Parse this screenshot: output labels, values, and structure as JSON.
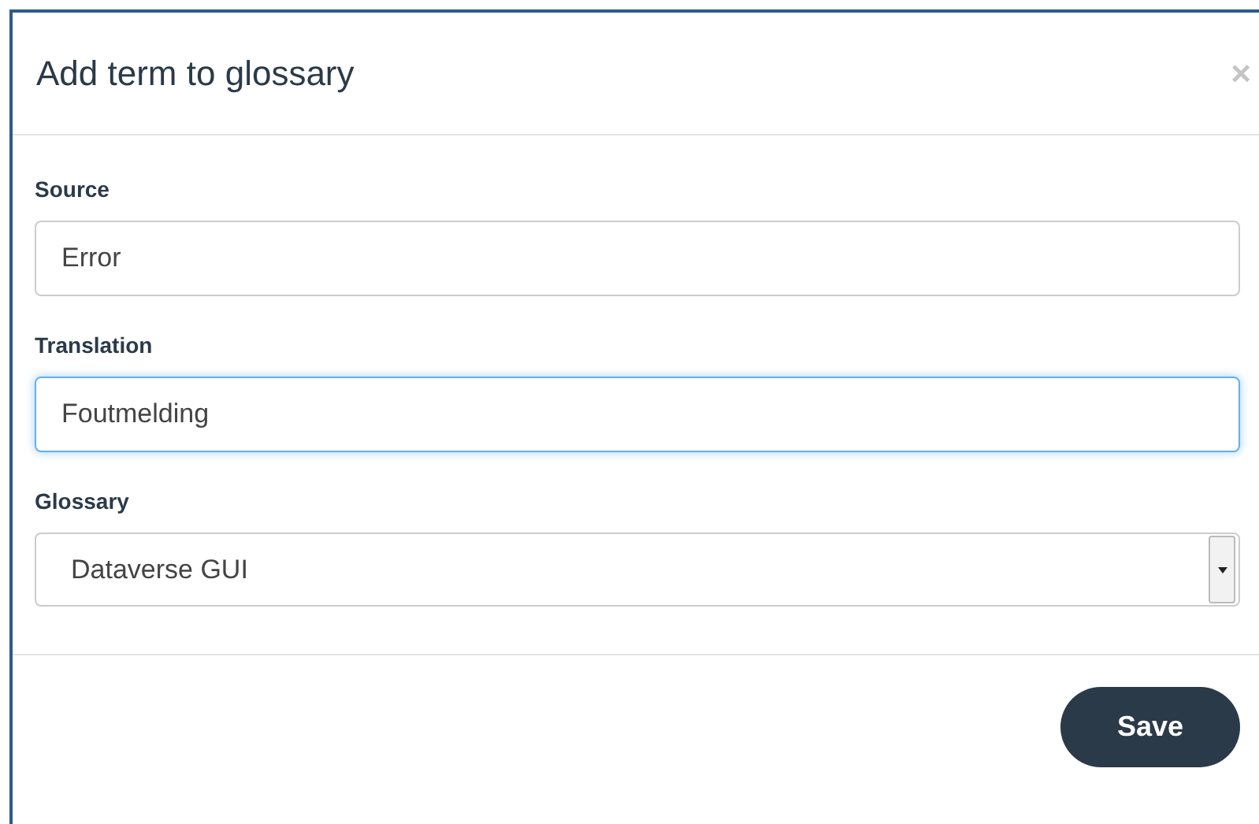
{
  "dialog": {
    "title": "Add term to glossary",
    "close": "×"
  },
  "fields": [
    {
      "kind": "text",
      "label": "Source",
      "value": "Error",
      "focused": false
    },
    {
      "kind": "text",
      "label": "Translation",
      "value": "Foutmelding",
      "focused": true
    },
    {
      "kind": "select",
      "label": "Glossary",
      "value": "Dataverse GUI",
      "focused": false
    }
  ],
  "buttons": [
    "Save"
  ]
}
